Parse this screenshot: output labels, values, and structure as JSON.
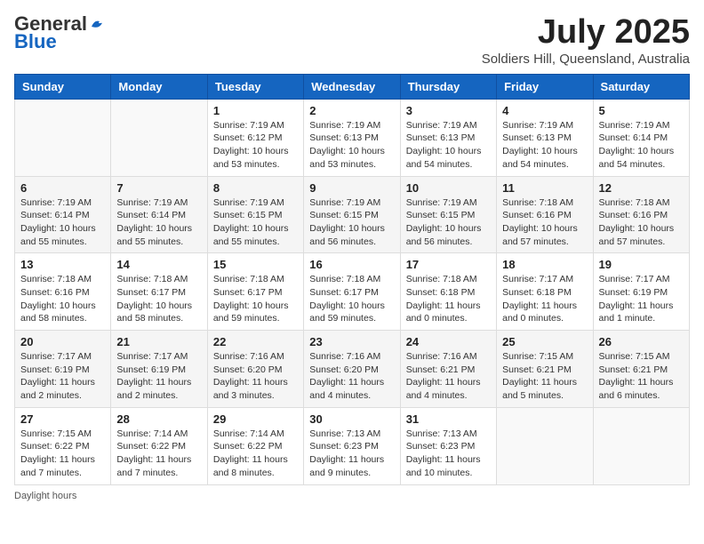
{
  "logo": {
    "general": "General",
    "blue": "Blue"
  },
  "header": {
    "month_title": "July 2025",
    "location": "Soldiers Hill, Queensland, Australia"
  },
  "weekdays": [
    "Sunday",
    "Monday",
    "Tuesday",
    "Wednesday",
    "Thursday",
    "Friday",
    "Saturday"
  ],
  "weeks": [
    [
      {
        "day": "",
        "sunrise": "",
        "sunset": "",
        "daylight": ""
      },
      {
        "day": "",
        "sunrise": "",
        "sunset": "",
        "daylight": ""
      },
      {
        "day": "1",
        "sunrise": "Sunrise: 7:19 AM",
        "sunset": "Sunset: 6:12 PM",
        "daylight": "Daylight: 10 hours and 53 minutes."
      },
      {
        "day": "2",
        "sunrise": "Sunrise: 7:19 AM",
        "sunset": "Sunset: 6:13 PM",
        "daylight": "Daylight: 10 hours and 53 minutes."
      },
      {
        "day": "3",
        "sunrise": "Sunrise: 7:19 AM",
        "sunset": "Sunset: 6:13 PM",
        "daylight": "Daylight: 10 hours and 54 minutes."
      },
      {
        "day": "4",
        "sunrise": "Sunrise: 7:19 AM",
        "sunset": "Sunset: 6:13 PM",
        "daylight": "Daylight: 10 hours and 54 minutes."
      },
      {
        "day": "5",
        "sunrise": "Sunrise: 7:19 AM",
        "sunset": "Sunset: 6:14 PM",
        "daylight": "Daylight: 10 hours and 54 minutes."
      }
    ],
    [
      {
        "day": "6",
        "sunrise": "Sunrise: 7:19 AM",
        "sunset": "Sunset: 6:14 PM",
        "daylight": "Daylight: 10 hours and 55 minutes."
      },
      {
        "day": "7",
        "sunrise": "Sunrise: 7:19 AM",
        "sunset": "Sunset: 6:14 PM",
        "daylight": "Daylight: 10 hours and 55 minutes."
      },
      {
        "day": "8",
        "sunrise": "Sunrise: 7:19 AM",
        "sunset": "Sunset: 6:15 PM",
        "daylight": "Daylight: 10 hours and 55 minutes."
      },
      {
        "day": "9",
        "sunrise": "Sunrise: 7:19 AM",
        "sunset": "Sunset: 6:15 PM",
        "daylight": "Daylight: 10 hours and 56 minutes."
      },
      {
        "day": "10",
        "sunrise": "Sunrise: 7:19 AM",
        "sunset": "Sunset: 6:15 PM",
        "daylight": "Daylight: 10 hours and 56 minutes."
      },
      {
        "day": "11",
        "sunrise": "Sunrise: 7:18 AM",
        "sunset": "Sunset: 6:16 PM",
        "daylight": "Daylight: 10 hours and 57 minutes."
      },
      {
        "day": "12",
        "sunrise": "Sunrise: 7:18 AM",
        "sunset": "Sunset: 6:16 PM",
        "daylight": "Daylight: 10 hours and 57 minutes."
      }
    ],
    [
      {
        "day": "13",
        "sunrise": "Sunrise: 7:18 AM",
        "sunset": "Sunset: 6:16 PM",
        "daylight": "Daylight: 10 hours and 58 minutes."
      },
      {
        "day": "14",
        "sunrise": "Sunrise: 7:18 AM",
        "sunset": "Sunset: 6:17 PM",
        "daylight": "Daylight: 10 hours and 58 minutes."
      },
      {
        "day": "15",
        "sunrise": "Sunrise: 7:18 AM",
        "sunset": "Sunset: 6:17 PM",
        "daylight": "Daylight: 10 hours and 59 minutes."
      },
      {
        "day": "16",
        "sunrise": "Sunrise: 7:18 AM",
        "sunset": "Sunset: 6:17 PM",
        "daylight": "Daylight: 10 hours and 59 minutes."
      },
      {
        "day": "17",
        "sunrise": "Sunrise: 7:18 AM",
        "sunset": "Sunset: 6:18 PM",
        "daylight": "Daylight: 11 hours and 0 minutes."
      },
      {
        "day": "18",
        "sunrise": "Sunrise: 7:17 AM",
        "sunset": "Sunset: 6:18 PM",
        "daylight": "Daylight: 11 hours and 0 minutes."
      },
      {
        "day": "19",
        "sunrise": "Sunrise: 7:17 AM",
        "sunset": "Sunset: 6:19 PM",
        "daylight": "Daylight: 11 hours and 1 minute."
      }
    ],
    [
      {
        "day": "20",
        "sunrise": "Sunrise: 7:17 AM",
        "sunset": "Sunset: 6:19 PM",
        "daylight": "Daylight: 11 hours and 2 minutes."
      },
      {
        "day": "21",
        "sunrise": "Sunrise: 7:17 AM",
        "sunset": "Sunset: 6:19 PM",
        "daylight": "Daylight: 11 hours and 2 minutes."
      },
      {
        "day": "22",
        "sunrise": "Sunrise: 7:16 AM",
        "sunset": "Sunset: 6:20 PM",
        "daylight": "Daylight: 11 hours and 3 minutes."
      },
      {
        "day": "23",
        "sunrise": "Sunrise: 7:16 AM",
        "sunset": "Sunset: 6:20 PM",
        "daylight": "Daylight: 11 hours and 4 minutes."
      },
      {
        "day": "24",
        "sunrise": "Sunrise: 7:16 AM",
        "sunset": "Sunset: 6:21 PM",
        "daylight": "Daylight: 11 hours and 4 minutes."
      },
      {
        "day": "25",
        "sunrise": "Sunrise: 7:15 AM",
        "sunset": "Sunset: 6:21 PM",
        "daylight": "Daylight: 11 hours and 5 minutes."
      },
      {
        "day": "26",
        "sunrise": "Sunrise: 7:15 AM",
        "sunset": "Sunset: 6:21 PM",
        "daylight": "Daylight: 11 hours and 6 minutes."
      }
    ],
    [
      {
        "day": "27",
        "sunrise": "Sunrise: 7:15 AM",
        "sunset": "Sunset: 6:22 PM",
        "daylight": "Daylight: 11 hours and 7 minutes."
      },
      {
        "day": "28",
        "sunrise": "Sunrise: 7:14 AM",
        "sunset": "Sunset: 6:22 PM",
        "daylight": "Daylight: 11 hours and 7 minutes."
      },
      {
        "day": "29",
        "sunrise": "Sunrise: 7:14 AM",
        "sunset": "Sunset: 6:22 PM",
        "daylight": "Daylight: 11 hours and 8 minutes."
      },
      {
        "day": "30",
        "sunrise": "Sunrise: 7:13 AM",
        "sunset": "Sunset: 6:23 PM",
        "daylight": "Daylight: 11 hours and 9 minutes."
      },
      {
        "day": "31",
        "sunrise": "Sunrise: 7:13 AM",
        "sunset": "Sunset: 6:23 PM",
        "daylight": "Daylight: 11 hours and 10 minutes."
      },
      {
        "day": "",
        "sunrise": "",
        "sunset": "",
        "daylight": ""
      },
      {
        "day": "",
        "sunrise": "",
        "sunset": "",
        "daylight": ""
      }
    ]
  ],
  "footer": {
    "note": "Daylight hours"
  }
}
